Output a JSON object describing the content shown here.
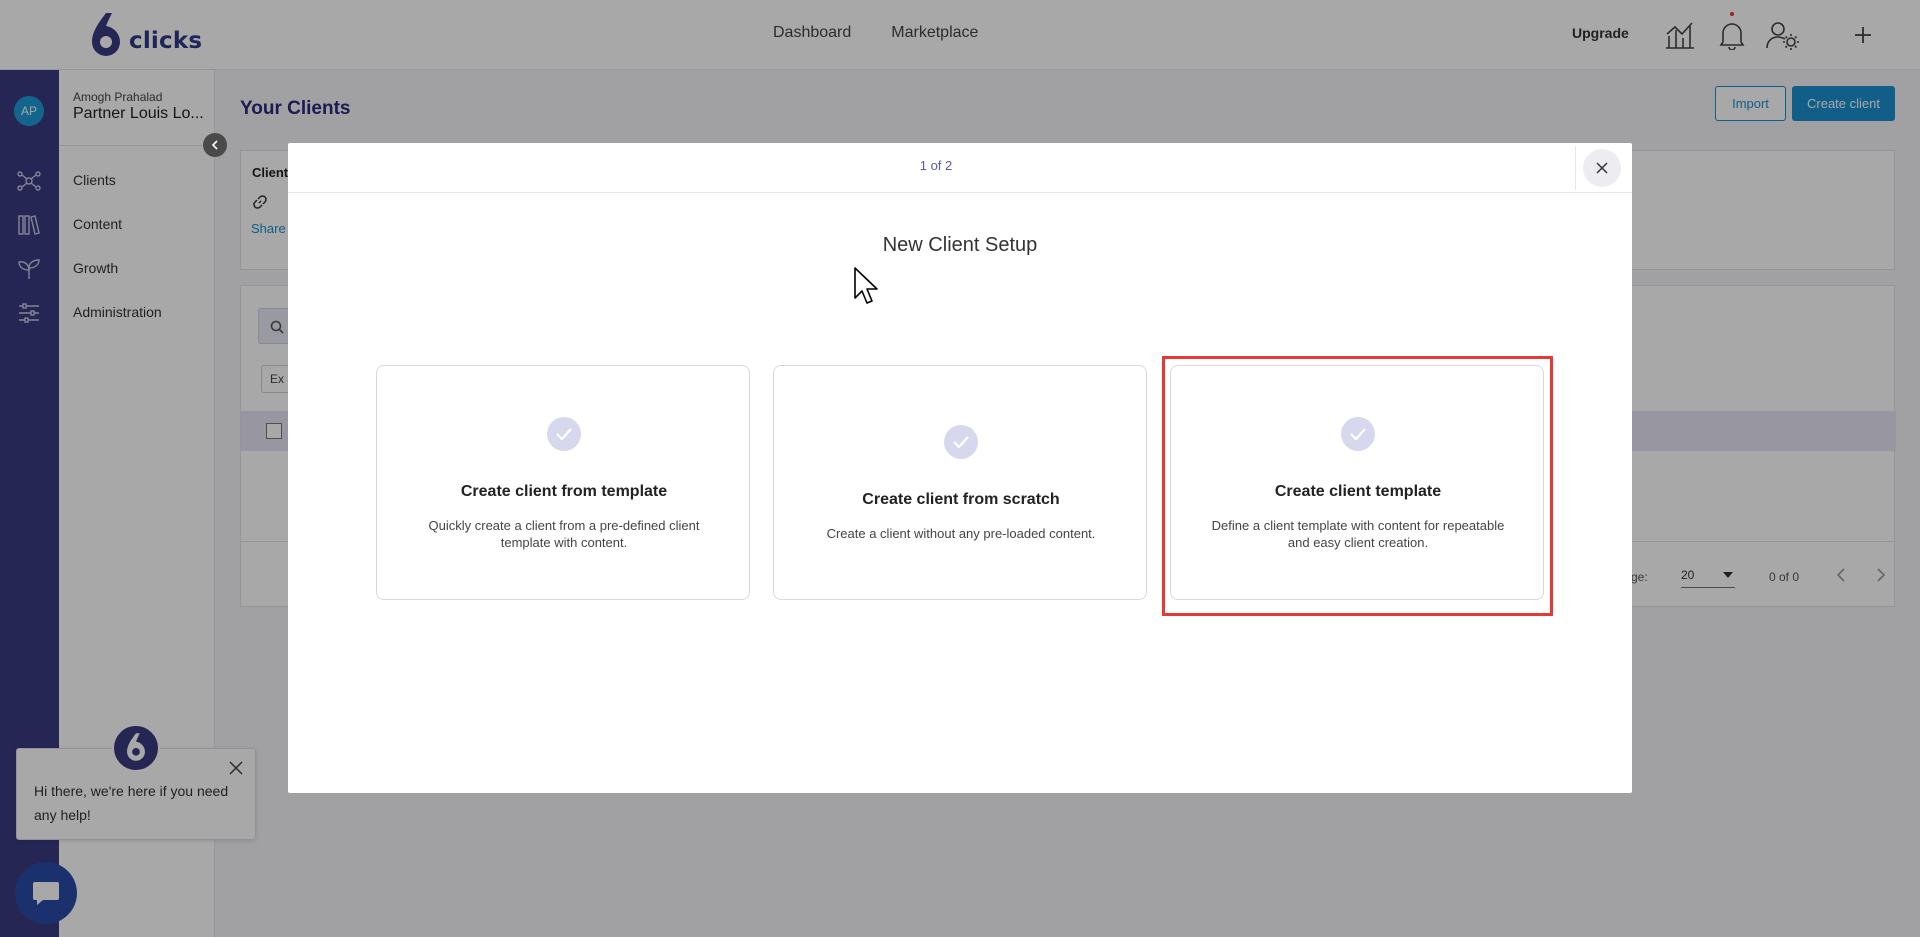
{
  "header": {
    "logo_text": "clicks",
    "nav": [
      "Dashboard",
      "Marketplace"
    ],
    "upgrade_label": "Upgrade",
    "icons": [
      "analytics-icon",
      "bell-icon",
      "user-settings-icon",
      "plus-icon"
    ]
  },
  "user": {
    "initials": "AP",
    "name": "Amogh Prahalad",
    "partner": "Partner Louis Lo..."
  },
  "sidebar": {
    "items": [
      {
        "label": "Clients",
        "icon": "network-icon"
      },
      {
        "label": "Content",
        "icon": "library-icon"
      },
      {
        "label": "Growth",
        "icon": "sprout-icon"
      },
      {
        "label": "Administration",
        "icon": "sliders-icon"
      }
    ]
  },
  "page": {
    "title": "Your Clients",
    "import_label": "Import",
    "create_label": "Create client",
    "card_title": "Client",
    "share_label": "Share",
    "filter_label": "Ex",
    "pager_label": "ge:",
    "page_size": "20",
    "pager_count": "0 of 0"
  },
  "modal": {
    "step": "1 of 2",
    "title": "New Client Setup",
    "options": [
      {
        "title": "Create client from template",
        "desc": "Quickly create a client from a pre-defined client template with content."
      },
      {
        "title": "Create client from scratch",
        "desc": "Create a client without any pre-loaded content."
      },
      {
        "title": "Create client template",
        "desc": "Define a client template with content for repeatable and easy client creation."
      }
    ]
  },
  "chat": {
    "message": "Hi there, we're here if you need any help!"
  },
  "colors": {
    "brand": "#3a3a82",
    "accent": "#1a8fd1",
    "highlight": "#e53935"
  }
}
